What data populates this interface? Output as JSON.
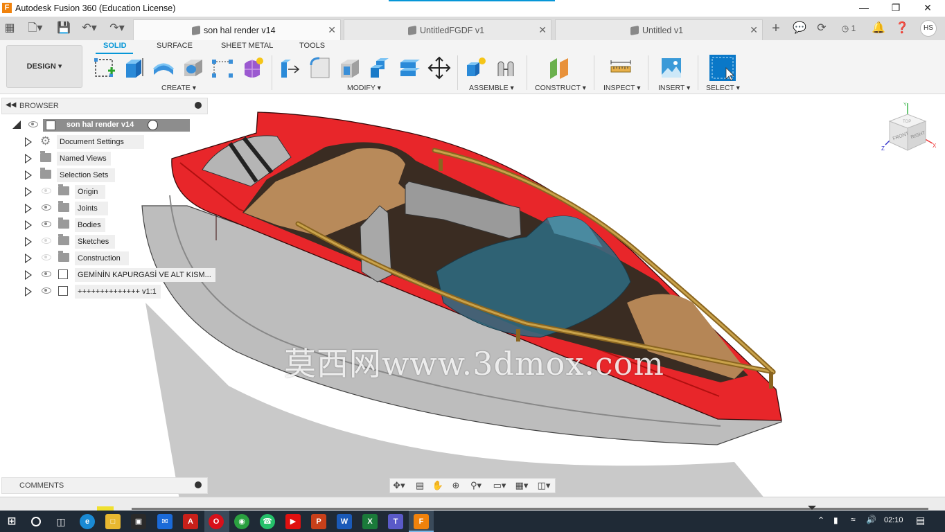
{
  "app": {
    "window_title": "Autodesk Fusion 360 (Education License)",
    "logo_letter": "F",
    "accent": "#0696d7"
  },
  "tabs": [
    {
      "label": "son hal render v14",
      "active": true
    },
    {
      "label": "UntitledFGDF v1",
      "active": false
    },
    {
      "label": "Untitled v1",
      "active": false
    }
  ],
  "header_right": {
    "job_count": "1",
    "user_initials": "HS"
  },
  "ribbon": {
    "workspace": "DESIGN",
    "tabs": [
      "SOLID",
      "SURFACE",
      "SHEET METAL",
      "TOOLS"
    ],
    "groups": [
      "CREATE",
      "MODIFY",
      "ASSEMBLE",
      "CONSTRUCT",
      "INSPECT",
      "INSERT",
      "SELECT"
    ]
  },
  "browser": {
    "header": "BROWSER",
    "root": "son hal render v14",
    "items": [
      {
        "label": "Document Settings",
        "icon": "gear-icon"
      },
      {
        "label": "Named Views",
        "icon": "folder-icon"
      },
      {
        "label": "Selection Sets",
        "icon": "folder-icon"
      },
      {
        "label": "Origin",
        "icon": "folder-icon",
        "visible": false
      },
      {
        "label": "Joints",
        "icon": "folder-icon",
        "visible": true
      },
      {
        "label": "Bodies",
        "icon": "folder-icon",
        "visible": true
      },
      {
        "label": "Sketches",
        "icon": "folder-icon",
        "visible": false
      },
      {
        "label": "Construction",
        "icon": "folder-icon",
        "visible": null
      },
      {
        "label": "GEMİNİN KAPURGASİ VE ALT KISM...",
        "icon": "component-icon",
        "visible": true
      },
      {
        "label": "++++++++++++++ v1:1",
        "icon": "component-icon",
        "visible": true
      }
    ]
  },
  "comments": {
    "header": "COMMENTS"
  },
  "viewcube": {
    "front": "FRONT",
    "right": "RIGHT",
    "top": "TOP"
  },
  "watermark": "莫西网www.3dmox.com",
  "taskbar": {
    "clock": "02:10"
  }
}
